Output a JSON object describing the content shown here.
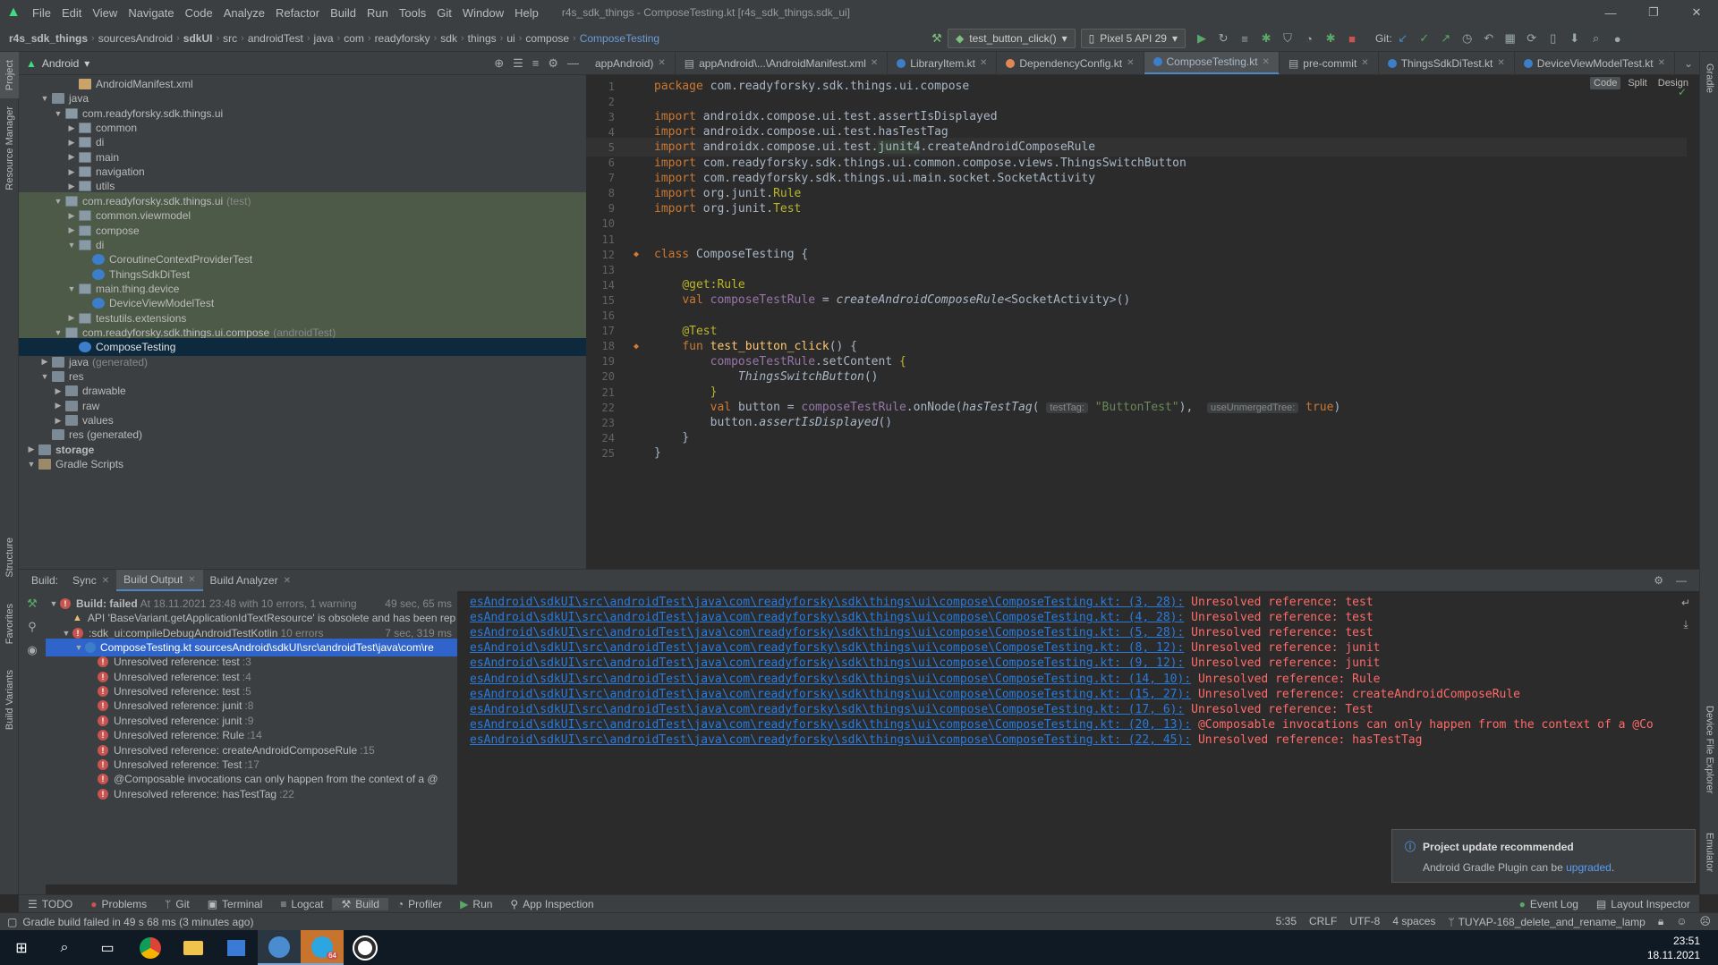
{
  "menubar": {
    "items": [
      "File",
      "Edit",
      "View",
      "Navigate",
      "Code",
      "Analyze",
      "Refactor",
      "Build",
      "Run",
      "Tools",
      "Git",
      "Window",
      "Help"
    ],
    "title": "r4s_sdk_things - ComposeTesting.kt [r4s_sdk_things.sdk_ui]"
  },
  "breadcrumb": [
    "r4s_sdk_things",
    "sourcesAndroid",
    "sdkUI",
    "src",
    "androidTest",
    "java",
    "com",
    "readyforsky",
    "sdk",
    "things",
    "ui",
    "compose",
    "ComposeTesting"
  ],
  "toolbar": {
    "run_config": "test_button_click()",
    "device": "Pixel 5 API 29",
    "git_label": "Git:"
  },
  "project_panel": {
    "view": "Android",
    "tree": [
      {
        "label": "AndroidManifest.xml",
        "icon": "file-xml-icon",
        "depth": 3,
        "arrow": ""
      },
      {
        "label": "java",
        "icon": "folder-icon",
        "depth": 1,
        "arrow": "open"
      },
      {
        "label": "com.readyforsky.sdk.things.ui",
        "icon": "package-icon",
        "depth": 2,
        "arrow": "open"
      },
      {
        "label": "common",
        "icon": "package-icon",
        "depth": 3,
        "arrow": "closed"
      },
      {
        "label": "di",
        "icon": "package-icon",
        "depth": 3,
        "arrow": "closed"
      },
      {
        "label": "main",
        "icon": "package-icon",
        "depth": 3,
        "arrow": "closed"
      },
      {
        "label": "navigation",
        "icon": "package-icon",
        "depth": 3,
        "arrow": "closed"
      },
      {
        "label": "utils",
        "icon": "package-icon",
        "depth": 3,
        "arrow": "closed"
      },
      {
        "label": "com.readyforsky.sdk.things.ui",
        "suffix": "(test)",
        "icon": "package-icon",
        "depth": 2,
        "arrow": "open",
        "hl": true
      },
      {
        "label": "common.viewmodel",
        "icon": "package-icon",
        "depth": 3,
        "arrow": "closed",
        "hl": true
      },
      {
        "label": "compose",
        "icon": "package-icon",
        "depth": 3,
        "arrow": "closed",
        "hl": true
      },
      {
        "label": "di",
        "icon": "package-icon",
        "depth": 3,
        "arrow": "open",
        "hl": true
      },
      {
        "label": "CoroutineContextProviderTest",
        "icon": "kotlin-class-icon",
        "depth": 4,
        "arrow": "",
        "hl": true
      },
      {
        "label": "ThingsSdkDiTest",
        "icon": "kotlin-class-icon",
        "depth": 4,
        "arrow": "",
        "hl": true
      },
      {
        "label": "main.thing.device",
        "icon": "package-icon",
        "depth": 3,
        "arrow": "open",
        "hl": true
      },
      {
        "label": "DeviceViewModelTest",
        "icon": "kotlin-class-icon",
        "depth": 4,
        "arrow": "",
        "hl": true
      },
      {
        "label": "testutils.extensions",
        "icon": "package-icon",
        "depth": 3,
        "arrow": "closed",
        "hl": true
      },
      {
        "label": "com.readyforsky.sdk.things.ui.compose",
        "suffix": "(androidTest)",
        "icon": "package-icon",
        "depth": 2,
        "arrow": "open",
        "hl": true
      },
      {
        "label": "ComposeTesting",
        "icon": "kotlin-class-icon",
        "depth": 3,
        "arrow": "",
        "sel": true
      },
      {
        "label": "java",
        "suffix": "(generated)",
        "icon": "folder-icon",
        "depth": 1,
        "arrow": "closed"
      },
      {
        "label": "res",
        "icon": "folder-icon",
        "depth": 1,
        "arrow": "open"
      },
      {
        "label": "drawable",
        "icon": "folder-icon",
        "depth": 2,
        "arrow": "closed"
      },
      {
        "label": "raw",
        "icon": "folder-icon",
        "depth": 2,
        "arrow": "closed"
      },
      {
        "label": "values",
        "icon": "folder-icon",
        "depth": 2,
        "arrow": "closed"
      },
      {
        "label": "res (generated)",
        "icon": "folder-icon",
        "depth": 1,
        "arrow": ""
      },
      {
        "label": "storage",
        "icon": "module-icon",
        "depth": 0,
        "arrow": "closed",
        "bold": true
      },
      {
        "label": "Gradle Scripts",
        "icon": "gradle-icon",
        "depth": 0,
        "arrow": "open"
      }
    ]
  },
  "editor_tabs": [
    {
      "label": "appAndroid)",
      "icon": ""
    },
    {
      "label": "appAndroid\\...\\AndroidManifest.xml",
      "icon": "file-xml-icon"
    },
    {
      "label": "LibraryItem.kt",
      "icon": "kotlin-class-icon"
    },
    {
      "label": "DependencyConfig.kt",
      "icon": "kotlin-object-icon"
    },
    {
      "label": "ComposeTesting.kt",
      "icon": "kotlin-class-icon",
      "active": true
    },
    {
      "label": "pre-commit",
      "icon": "file-icon"
    },
    {
      "label": "ThingsSdkDiTest.kt",
      "icon": "kotlin-class-icon"
    },
    {
      "label": "DeviceViewModelTest.kt",
      "icon": "kotlin-class-icon"
    }
  ],
  "view_modes": [
    "Code",
    "Split",
    "Design"
  ],
  "code_lines": [
    {
      "n": "1",
      "html": "<span class='kw'>package </span>com.readyforsky.sdk.things.ui.compose"
    },
    {
      "n": "2",
      "html": ""
    },
    {
      "n": "3",
      "html": "<span class='kw'>import </span>androidx.compose.ui.test.assertIsDisplayed"
    },
    {
      "n": "4",
      "html": "<span class='kw'>import </span>androidx.compose.ui.test.hasTestTag"
    },
    {
      "n": "5",
      "html": "<span class='kw'>import </span>androidx.compose.ui.test.<span class='hl2'>junit4</span>.createAndroidComposeRule",
      "cur": true
    },
    {
      "n": "6",
      "html": "<span class='kw'>import </span>com.readyforsky.sdk.things.ui.common.compose.views.ThingsSwitchButton"
    },
    {
      "n": "7",
      "html": "<span class='kw'>import </span>com.readyforsky.sdk.things.ui.main.socket.SocketActivity"
    },
    {
      "n": "8",
      "html": "<span class='kw'>import </span>org.junit.<span class='an'>Rule</span>"
    },
    {
      "n": "9",
      "html": "<span class='kw'>import </span>org.junit.<span class='an'>Test</span>"
    },
    {
      "n": "10",
      "html": ""
    },
    {
      "n": "11",
      "html": ""
    },
    {
      "n": "12",
      "html": "<span class='kw'>class </span>ComposeTesting {",
      "gutter": true
    },
    {
      "n": "13",
      "html": ""
    },
    {
      "n": "14",
      "html": "    <span class='an'>@get:Rule</span>"
    },
    {
      "n": "15",
      "html": "    <span class='kw'>val </span><span class='pv'>composeTestRule</span> = <span class='it'>createAndroidComposeRule</span>&lt;SocketActivity&gt;()"
    },
    {
      "n": "16",
      "html": ""
    },
    {
      "n": "17",
      "html": "    <span class='an'>@Test</span>"
    },
    {
      "n": "18",
      "html": "    <span class='kw'>fun </span><span class='fn'>test_button_click</span>() {",
      "gutter": true
    },
    {
      "n": "19",
      "html": "        <span class='pv'>composeTestRule</span>.setContent <span class='an'>{</span>"
    },
    {
      "n": "20",
      "html": "            <span class='it'>ThingsSwitchButton</span>()"
    },
    {
      "n": "21",
      "html": "        <span class='an'>}</span>"
    },
    {
      "n": "22",
      "html": "        <span class='kw'>val </span>button = <span class='pv'>composeTestRule</span>.onNode(<span class='it'>hasTestTag</span>( <span class='hint'>testTag:</span> <span class='str'>\"ButtonTest\"</span>),  <span class='hint'>useUnmergedTree:</span> <span class='kw'>true</span>)"
    },
    {
      "n": "23",
      "html": "        button.<span class='it'>assertIsDisplayed</span>()"
    },
    {
      "n": "24",
      "html": "    }"
    },
    {
      "n": "25",
      "html": "}"
    }
  ],
  "build_panel": {
    "tabs": [
      {
        "label": "Build:"
      },
      {
        "label": "Sync"
      },
      {
        "label": "Build Output",
        "active": true
      },
      {
        "label": "Build Analyzer"
      }
    ],
    "tree": [
      {
        "type": "err",
        "text": "Build: failed",
        "gray": "At 18.11.2021 23:48 with 10 errors, 1 warning",
        "meta": "49 sec, 65 ms",
        "depth": 0,
        "arrow": "open",
        "bold": true
      },
      {
        "type": "warn",
        "text": "API 'BaseVariant.getApplicationIdTextResource' is obsolete and has been rep",
        "depth": 1,
        "arrow": ""
      },
      {
        "type": "err",
        "text": ":sdk_ui:compileDebugAndroidTestKotlin",
        "gray": "10 errors",
        "meta": "7 sec, 319 ms",
        "depth": 1,
        "arrow": "open"
      },
      {
        "type": "kt",
        "text": "ComposeTesting.kt sourcesAndroid\\sdkUI\\src\\androidTest\\java\\com\\re",
        "depth": 2,
        "arrow": "open",
        "sel": true
      },
      {
        "type": "err",
        "text": "Unresolved reference: test",
        "gray": ":3",
        "depth": 3,
        "arrow": ""
      },
      {
        "type": "err",
        "text": "Unresolved reference: test",
        "gray": ":4",
        "depth": 3,
        "arrow": ""
      },
      {
        "type": "err",
        "text": "Unresolved reference: test",
        "gray": ":5",
        "depth": 3,
        "arrow": ""
      },
      {
        "type": "err",
        "text": "Unresolved reference: junit",
        "gray": ":8",
        "depth": 3,
        "arrow": ""
      },
      {
        "type": "err",
        "text": "Unresolved reference: junit",
        "gray": ":9",
        "depth": 3,
        "arrow": ""
      },
      {
        "type": "err",
        "text": "Unresolved reference: Rule",
        "gray": ":14",
        "depth": 3,
        "arrow": ""
      },
      {
        "type": "err",
        "text": "Unresolved reference: createAndroidComposeRule",
        "gray": ":15",
        "depth": 3,
        "arrow": ""
      },
      {
        "type": "err",
        "text": "Unresolved reference: Test",
        "gray": ":17",
        "depth": 3,
        "arrow": ""
      },
      {
        "type": "err",
        "text": "@Composable invocations can only happen from the context of a @",
        "depth": 3,
        "arrow": ""
      },
      {
        "type": "err",
        "text": "Unresolved reference: hasTestTag",
        "gray": ":22",
        "depth": 3,
        "arrow": ""
      }
    ],
    "output": [
      {
        "link": "esAndroid\\sdkUI\\src\\androidTest\\java\\com\\readyforsky\\sdk\\things\\ui\\compose\\ComposeTesting.kt: (3, 28):",
        "msg": " Unresolved reference: test"
      },
      {
        "link": "esAndroid\\sdkUI\\src\\androidTest\\java\\com\\readyforsky\\sdk\\things\\ui\\compose\\ComposeTesting.kt: (4, 28):",
        "msg": " Unresolved reference: test"
      },
      {
        "link": "esAndroid\\sdkUI\\src\\androidTest\\java\\com\\readyforsky\\sdk\\things\\ui\\compose\\ComposeTesting.kt: (5, 28):",
        "msg": " Unresolved reference: test"
      },
      {
        "link": "esAndroid\\sdkUI\\src\\androidTest\\java\\com\\readyforsky\\sdk\\things\\ui\\compose\\ComposeTesting.kt: (8, 12):",
        "msg": " Unresolved reference: junit"
      },
      {
        "link": "esAndroid\\sdkUI\\src\\androidTest\\java\\com\\readyforsky\\sdk\\things\\ui\\compose\\ComposeTesting.kt: (9, 12):",
        "msg": " Unresolved reference: junit"
      },
      {
        "link": "esAndroid\\sdkUI\\src\\androidTest\\java\\com\\readyforsky\\sdk\\things\\ui\\compose\\ComposeTesting.kt: (14, 10):",
        "msg": " Unresolved reference: Rule"
      },
      {
        "link": "esAndroid\\sdkUI\\src\\androidTest\\java\\com\\readyforsky\\sdk\\things\\ui\\compose\\ComposeTesting.kt: (15, 27):",
        "msg": " Unresolved reference: createAndroidComposeRule"
      },
      {
        "link": "esAndroid\\sdkUI\\src\\androidTest\\java\\com\\readyforsky\\sdk\\things\\ui\\compose\\ComposeTesting.kt: (17, 6):",
        "msg": " Unresolved reference: Test"
      },
      {
        "link": "esAndroid\\sdkUI\\src\\androidTest\\java\\com\\readyforsky\\sdk\\things\\ui\\compose\\ComposeTesting.kt: (20, 13):",
        "msg": " @Composable invocations can only happen from the context of a @Co"
      },
      {
        "link": "esAndroid\\sdkUI\\src\\androidTest\\java\\com\\readyforsky\\sdk\\things\\ui\\compose\\ComposeTesting.kt: (22, 45):",
        "msg": " Unresolved reference: hasTestTag"
      }
    ]
  },
  "notification": {
    "title": "Project update recommended",
    "body": "Android Gradle Plugin can be ",
    "link": "upgraded",
    "suffix": "."
  },
  "bottom_tools": {
    "left": [
      {
        "label": "TODO",
        "icon": "list-icon"
      },
      {
        "label": "Problems",
        "icon": "problems-icon"
      },
      {
        "label": "Git",
        "icon": "git-branch-icon"
      },
      {
        "label": "Terminal",
        "icon": "terminal-icon"
      },
      {
        "label": "Logcat",
        "icon": "logcat-icon"
      },
      {
        "label": "Build",
        "icon": "hammer-icon",
        "active": true
      },
      {
        "label": "Profiler",
        "icon": "profiler-icon"
      },
      {
        "label": "Run",
        "icon": "play-icon"
      },
      {
        "label": "App Inspection",
        "icon": "inspection-icon"
      }
    ],
    "right": [
      {
        "label": "Event Log",
        "icon": "event-log-icon"
      },
      {
        "label": "Layout Inspector",
        "icon": "layout-inspector-icon"
      }
    ]
  },
  "status": {
    "message": "Gradle build failed in 49 s 68 ms (3 minutes ago)",
    "position": "5:35",
    "line_sep": "CRLF",
    "encoding": "UTF-8",
    "indent": "4 spaces",
    "branch": "TUYAP-168_delete_and_rename_lamp"
  },
  "side_tabs": {
    "left": [
      "Project",
      "Resource Manager",
      "Structure",
      "Favorites",
      "Build Variants"
    ],
    "right": [
      "Gradle",
      "Device File Explorer",
      "Emulator"
    ]
  },
  "taskbar": {
    "time": "23:51",
    "date": "18.11.2021",
    "telegram_badge": "64"
  },
  "colors": {
    "accent": "#4a88c7",
    "error": "#c75450",
    "link": "#287bde",
    "selection": "#2f65ca",
    "android": "#3ddc84"
  }
}
